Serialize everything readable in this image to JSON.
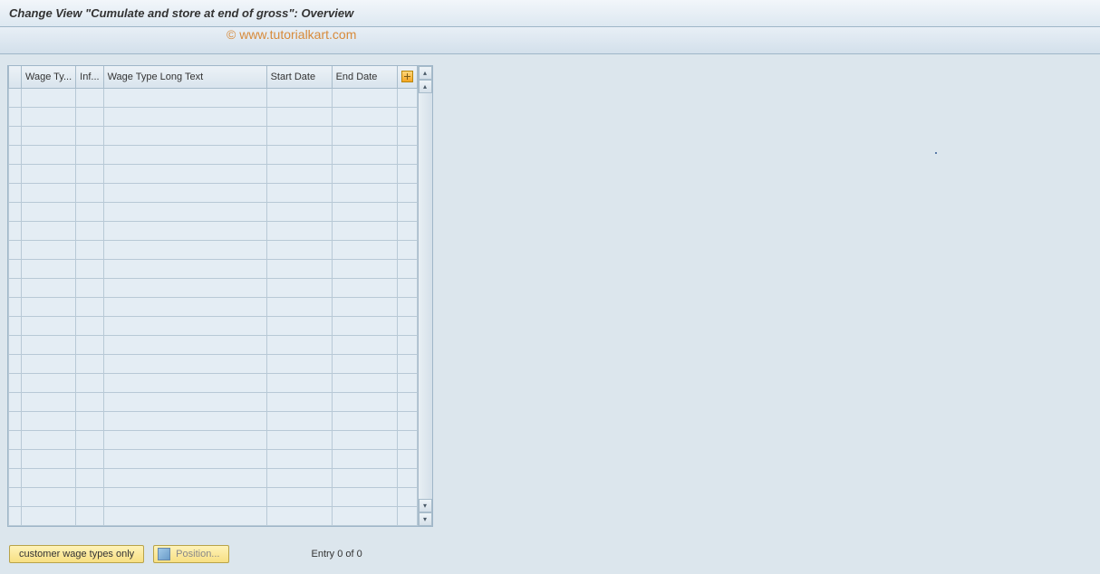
{
  "header": {
    "title": "Change View \"Cumulate and store at end of gross\": Overview"
  },
  "watermark": "© www.tutorialkart.com",
  "table": {
    "columns": {
      "select": "",
      "wage_type": "Wage Ty...",
      "inf": "Inf...",
      "long_text": "Wage Type Long Text",
      "start_date": "Start Date",
      "end_date": "End Date"
    },
    "row_count": 23,
    "icon_config": "configure-columns-icon"
  },
  "footer": {
    "customer_btn": "customer wage types only",
    "position_btn": "Position...",
    "entry_text": "Entry 0 of 0"
  }
}
